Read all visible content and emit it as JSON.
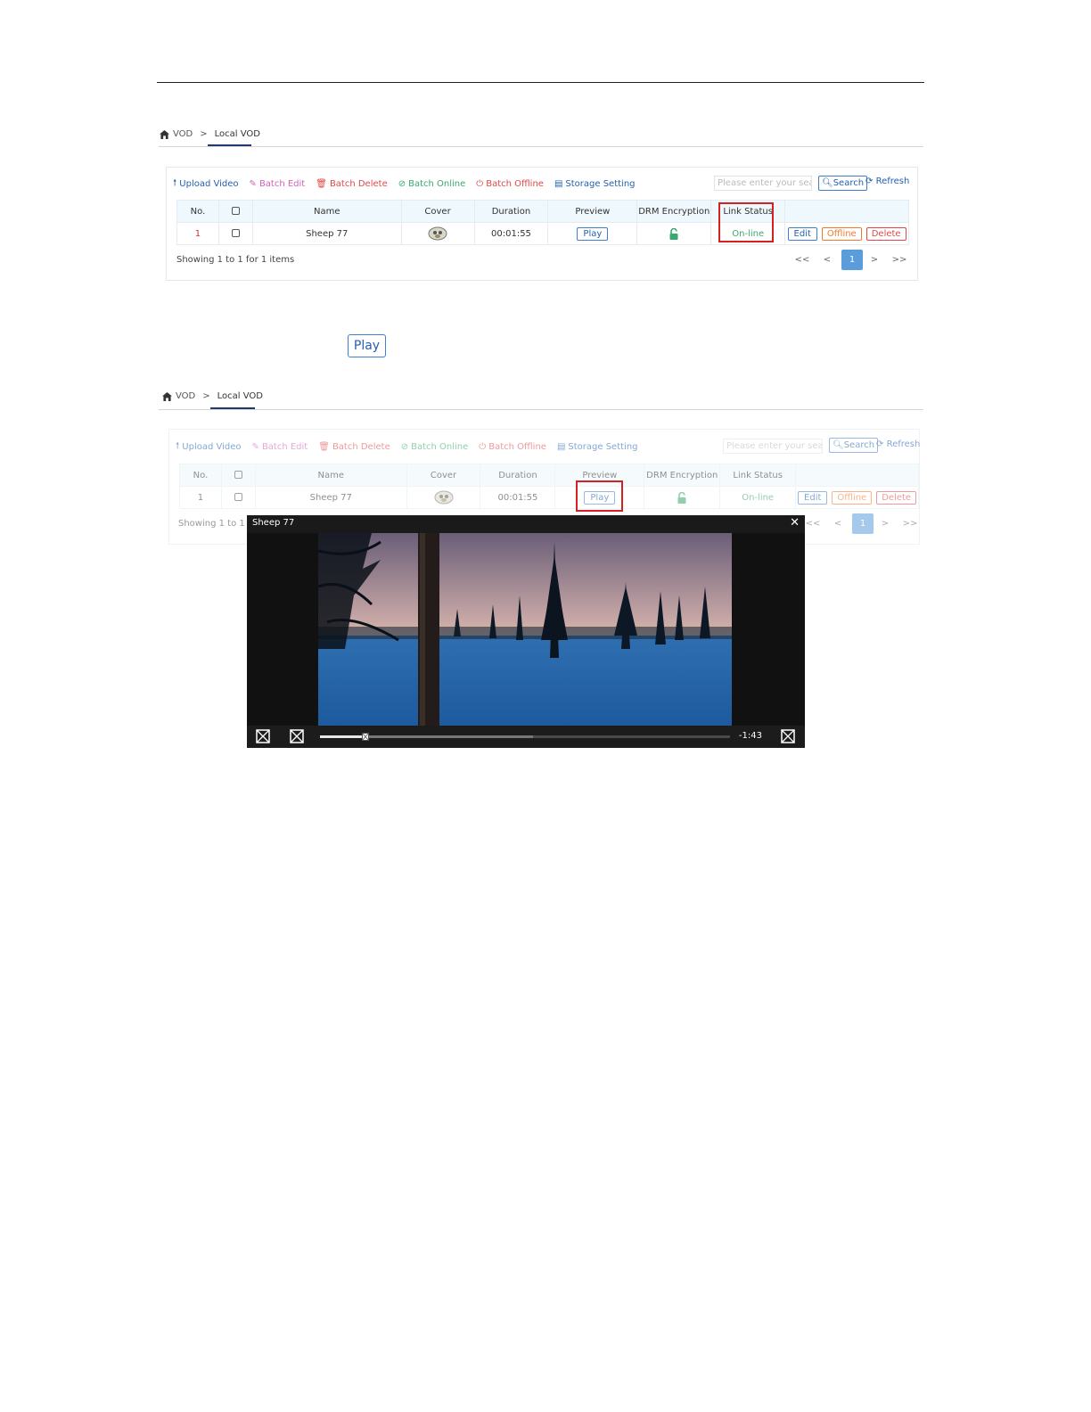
{
  "breadcrumb": {
    "root": "VOD",
    "separator": ">",
    "current": "Local VOD"
  },
  "toolbar": {
    "upload": "Upload Video",
    "batch_edit": "Batch Edit",
    "batch_delete": "Batch Delete",
    "batch_online": "Batch Online",
    "batch_offline": "Batch Offline",
    "storage": "Storage Setting"
  },
  "search": {
    "placeholder": "Please enter your search",
    "button": "Search",
    "refresh": "Refresh"
  },
  "table": {
    "headers": {
      "no": "No.",
      "name": "Name",
      "cover": "Cover",
      "duration": "Duration",
      "preview": "Preview",
      "drm": "DRM Encryption",
      "link_status": "Link Status"
    },
    "rows": [
      {
        "no": "1",
        "name": "Sheep 77",
        "duration": "00:01:55",
        "preview": "Play",
        "link_status": "On-line",
        "edit": "Edit",
        "offline": "Offline",
        "delete": "Delete"
      }
    ]
  },
  "footer": {
    "showing": "Showing 1 to 1 for 1 items",
    "showing_cut": "Showing 1 to 1 for"
  },
  "pager": {
    "first": "<<",
    "prev": "<",
    "current": "1",
    "next": ">",
    "last": ">>"
  },
  "play_button": "Play",
  "player": {
    "title": "Sheep 77",
    "close": "✕",
    "time_remaining": "-1:43",
    "progress": 0.11,
    "buffered": 0.52
  },
  "colors": {
    "accent": "#2361b0",
    "highlight": "#d42020",
    "header_bg": "#eef8fd"
  }
}
